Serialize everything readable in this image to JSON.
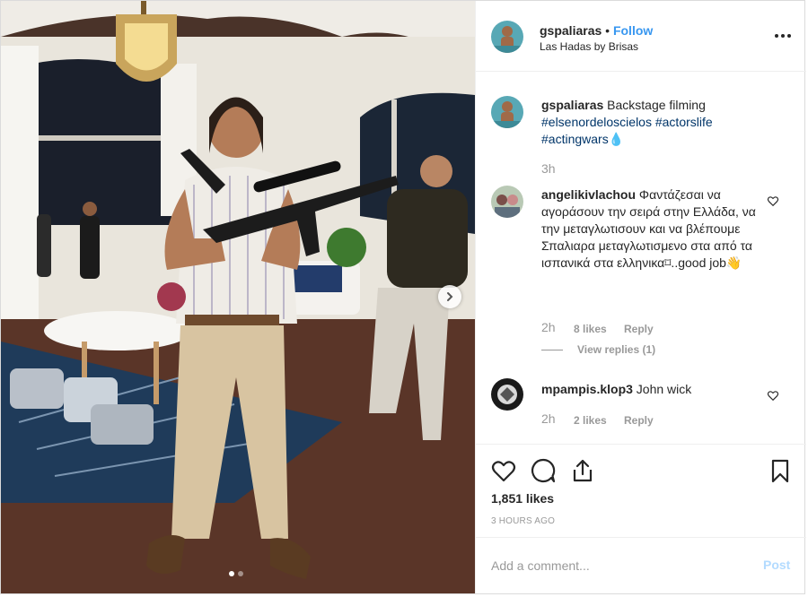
{
  "post": {
    "username": "gspaliaras",
    "separator": "•",
    "follow_label": "Follow",
    "location": "Las Hadas by Brisas",
    "more_icon": "more-options-icon",
    "photo": {
      "description_icon": "carousel-photo",
      "next_icon": "chevron-right-icon",
      "carousel_count": 2,
      "carousel_active": 0
    }
  },
  "caption": {
    "username": "gspaliaras",
    "text": " Backstage filming ",
    "tags": [
      "#elsenordeloscielos",
      "#actorslife",
      "#actingwars"
    ],
    "emoji": "💧",
    "time": "3h"
  },
  "comments": [
    {
      "username": "angelikivlachou",
      "text": " Φαντάζεσαι να αγοράσουν την σειρά στην Ελλάδα, να την μεταγλωτισουν και να βλέπουμε Σπαλιαρα μεταγλωτισμενο στα από τα ισπανικά στα ελληνικα⌑..good job👋",
      "time": "2h",
      "likes": "8 likes",
      "reply": "Reply",
      "view_replies": "View replies (1)"
    },
    {
      "username": "mpampis.klop3",
      "text": " John wick",
      "time": "2h",
      "likes": "2 likes",
      "reply": "Reply"
    }
  ],
  "actions": {
    "likes": "1,851 likes",
    "posted": "3 HOURS AGO"
  },
  "add_comment": {
    "placeholder": "Add a comment...",
    "post_label": "Post"
  },
  "colors": {
    "link": "#003569",
    "follow": "#3897f0",
    "muted": "#999999",
    "post_disabled": "#b3dbff"
  }
}
